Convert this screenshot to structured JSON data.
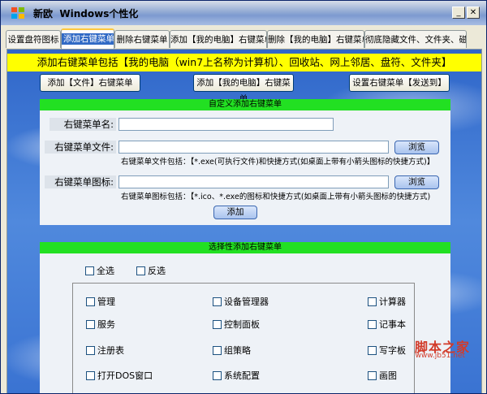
{
  "window": {
    "title": "Windows个性化",
    "title_prefix": "新欧"
  },
  "tabs": [
    "设置盘符图标",
    "添加右键菜单",
    "删除右键菜单",
    "添加【我的电脑】右键菜单",
    "删除【我的电脑】右键菜单",
    "彻底隐藏文件、文件夹、磁盘"
  ],
  "banner": "添加右键菜单包括【我的电脑（win7上名称为计算机）、回收站、网上邻居、盘符、文件夹】",
  "top_buttons": {
    "add_file": "添加【文件】右键菜单",
    "add_computer": "添加【我的电脑】右键菜单",
    "sendto": "设置右键菜单【发送到】"
  },
  "custom": {
    "header": "自定义添加右键菜单",
    "name_label": "右键菜单名:",
    "file_label": "右键菜单文件:",
    "icon_label": "右键菜单图标:",
    "browse": "浏览",
    "file_hint": "右键菜单文件包括：【*.exe(可执行文件)和快捷方式(如桌面上带有小箭头图标的快捷方式)】",
    "icon_hint": "右键菜单图标包括：【*.ico、*.exe的图标和快捷方式(如桌面上带有小箭头图标的快捷方式)",
    "add": "添加"
  },
  "selective": {
    "header": "选择性添加右键菜单",
    "select_all": "全选",
    "invert": "反选",
    "items": [
      "管理",
      "设备管理器",
      "计算器",
      "服务",
      "控制面板",
      "记事本",
      "注册表",
      "组策略",
      "写字板",
      "打开DOS窗口",
      "系统配置",
      "画图"
    ]
  },
  "watermark": {
    "main": "脚本之家",
    "sub": "www.jb51.net"
  },
  "colors": {
    "accent": "#316ac5",
    "banner": "#ffff00",
    "group_header": "#22e022"
  }
}
